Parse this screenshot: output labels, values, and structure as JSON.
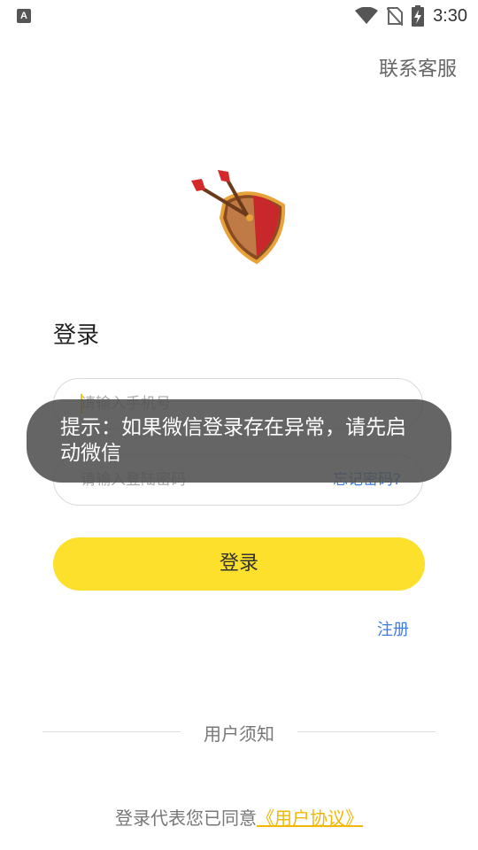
{
  "status_bar": {
    "app_icon_letter": "A",
    "time": "3:30",
    "icons": [
      "wifi-icon",
      "no-sim-icon",
      "battery-charging-icon"
    ]
  },
  "header": {
    "support_label": "联系客服"
  },
  "logo": {
    "icon": "shield-with-arrows-logo",
    "colors": {
      "red": "#c8272b",
      "wood": "#b06a3a",
      "gold": "#e8a23a"
    }
  },
  "login": {
    "heading": "登录",
    "phone_placeholder": "请输入手机号",
    "password_placeholder": "请输入登陆密码",
    "forgot_label": "忘记密码?",
    "submit_label": "登录",
    "register_label": "注册"
  },
  "footer": {
    "notice_label": "用户须知",
    "agreement_prefix": "登录代表您已同意",
    "agreement_link": "《用户协议》"
  },
  "toast": {
    "message": "提示：如果微信登录存在异常，请先启动微信"
  },
  "colors": {
    "accent_yellow": "#fde02b",
    "link_blue": "#3b7ddd",
    "link_gold": "#f2b705"
  }
}
